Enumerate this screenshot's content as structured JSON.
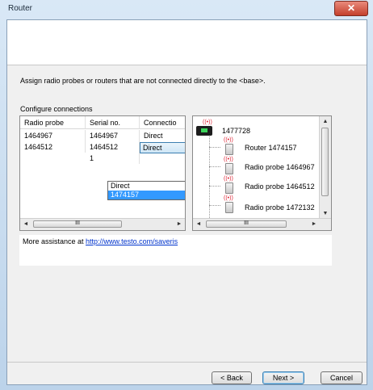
{
  "window": {
    "title": "Router",
    "close_glyph": "✕"
  },
  "description": "Assign radio probes or routers that are not connected directly to the <base>.",
  "configure_label": "Configure connections",
  "grid": {
    "columns": [
      "Radio probe",
      "Serial no.",
      "Connectio"
    ],
    "rows": [
      [
        "1464967",
        "1464967",
        "Direct"
      ],
      [
        "1464512",
        "1464512",
        "Direct"
      ]
    ],
    "partial_cell": "1",
    "dropdown_options": [
      "Direct",
      "1474157"
    ],
    "dropdown_selected_index": 1
  },
  "tree": {
    "root": "1477728",
    "children": [
      "Router 1474157",
      "Radio probe 1464967",
      "Radio probe 1464512",
      "Radio probe 1472132"
    ]
  },
  "scroll": {
    "left": "◄",
    "right": "►",
    "up": "▲",
    "down": "▼",
    "grip": "III"
  },
  "assist": {
    "prefix": "More assistance at ",
    "link": "http://www.testo.com/saveris"
  },
  "buttons": {
    "back": "< Back",
    "next": "Next >",
    "cancel": "Cancel"
  }
}
